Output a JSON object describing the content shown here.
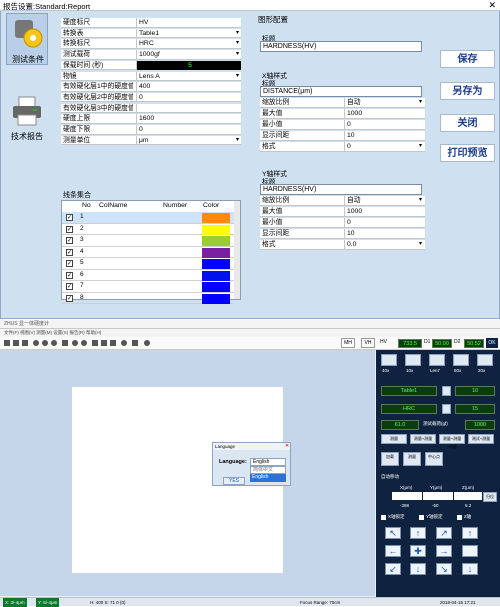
{
  "window": {
    "title": "报告设置:Standard:Report",
    "close": "✕"
  },
  "nav": {
    "test_conditions": "测试条件",
    "tech_report": "技术报告"
  },
  "hardness_rows": [
    {
      "k": "硬度标尺",
      "v": "HV",
      "dd": ""
    },
    {
      "k": "转换表",
      "v": "Table1",
      "dd": "▾"
    },
    {
      "k": "转换标尺",
      "v": "HRC",
      "dd": "▾"
    },
    {
      "k": "测试载荷",
      "v": "1000gf",
      "dd": "▾"
    },
    {
      "k": "保载时间 (秒)",
      "v": "5",
      "dd": ""
    },
    {
      "k": "物镜",
      "v": "Lens A",
      "dd": "▾"
    },
    {
      "k": "有效硬化层1中的硬度值",
      "v": "400",
      "dd": ""
    },
    {
      "k": "有效硬化层2中的硬度值",
      "v": "0",
      "dd": ""
    },
    {
      "k": "有效硬化层3中的硬度值",
      "v": "",
      "dd": ""
    },
    {
      "k": "硬度上限",
      "v": "1600",
      "dd": ""
    },
    {
      "k": "硬度下限",
      "v": "0",
      "dd": ""
    },
    {
      "k": "测量单位",
      "v": "μm",
      "dd": "▾"
    }
  ],
  "chart_config": {
    "section": "图形配置",
    "title_label": "标题",
    "title_value": "HARDNESS(HV)",
    "xaxis": {
      "section": "X轴样式",
      "title_label": "标题",
      "title_value": "DISTANCE(μm)",
      "rows": [
        {
          "k": "缩放比例",
          "v": "自动",
          "dd": "▾"
        },
        {
          "k": "最大值",
          "v": "1000",
          "dd": ""
        },
        {
          "k": "最小值",
          "v": "0",
          "dd": ""
        },
        {
          "k": "显示间距",
          "v": "10",
          "dd": ""
        },
        {
          "k": "格式",
          "v": "0",
          "dd": "▾"
        }
      ]
    },
    "yaxis": {
      "section": "Y轴样式",
      "title_label": "标题",
      "title_value": "HARDNESS(HV)",
      "rows": [
        {
          "k": "缩放比例",
          "v": "自动",
          "dd": "▾"
        },
        {
          "k": "最大值",
          "v": "1000",
          "dd": ""
        },
        {
          "k": "最小值",
          "v": "0",
          "dd": ""
        },
        {
          "k": "显示间距",
          "v": "10",
          "dd": ""
        },
        {
          "k": "格式",
          "v": "0.0",
          "dd": "▾"
        }
      ]
    }
  },
  "line_set": {
    "section": "线条集合",
    "headers": {
      "no": "No",
      "colname": "ColName",
      "number": "Number",
      "color": "Color"
    },
    "rows": [
      {
        "no": "1",
        "checked": "✓",
        "color": "#ff8c00"
      },
      {
        "no": "2",
        "checked": "✓",
        "color": "#ffff00"
      },
      {
        "no": "3",
        "checked": "✓",
        "color": "#9acd32"
      },
      {
        "no": "4",
        "checked": "✓",
        "color": "#7b1fa2"
      },
      {
        "no": "5",
        "checked": "✓",
        "color": "#0000ff"
      },
      {
        "no": "6",
        "checked": "✓",
        "color": "#0011ee"
      },
      {
        "no": "7",
        "checked": "✓",
        "color": "#0000ff"
      },
      {
        "no": "8",
        "checked": "✓",
        "color": "#0000ff"
      }
    ]
  },
  "buttons": {
    "save": "保存",
    "save_as": "另存为",
    "close": "关闭",
    "print_preview": "打印预览"
  },
  "app2": {
    "title": "ZHUS 显一体硬度计",
    "menu": "文件(F)   视图(V)   测量(M)   设置(S)   报告(R)   帮助(H)",
    "mh": "MH",
    "vh": "VH",
    "hv": "HV",
    "d1_val": "733.5",
    "d1_lbl": "D1",
    "d1_b": "50.00",
    "d2_lbl": "D2",
    "d2_val": "50.00",
    "d2_b": "50.52",
    "ok": "OK",
    "lens_labels": [
      "40x",
      "10x",
      "Len7",
      "60x",
      "20x"
    ],
    "table_name": "Table1",
    "table_num": "10",
    "conv": "HRC",
    "conv_num": "15",
    "load_val": "61.0",
    "load_lbl": "测试载荷(gf)",
    "load_num": "1000",
    "btns_a": [
      "测量",
      "测量+测量",
      "测量+测量+测量",
      "测试+测量"
    ],
    "btns_b": [
      "加载",
      "测量",
      "中心点"
    ],
    "pos_title": "自动移动",
    "axes": {
      "x": "X(μm)",
      "y": "Y(μm)",
      "z": "Z(μm)"
    },
    "axis_vals": {
      "x": "-398",
      "y": "-50",
      "z": "5.2"
    },
    "zero": "归位",
    "chk": [
      "X轴锁定",
      "Y轴锁定",
      "Z轴"
    ],
    "lang_title": "Language",
    "lang_label": "Language:",
    "lang_value": "English",
    "lang_options": [
      "简体中文",
      "English"
    ],
    "yes": "YES",
    "status": {
      "x": "X: 3/-4μm",
      "y": "Y: 5/-4μm",
      "size": "H: 400   S: 71 0 (0)",
      "focus": "Focus Range: 70cm",
      "time": "2018-04-15 17:21"
    }
  }
}
